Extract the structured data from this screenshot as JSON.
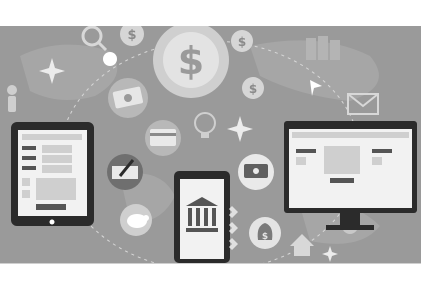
{
  "illustration": {
    "subject": "digital-banking-devices",
    "colors": {
      "background": "#9a9a9a",
      "light_circle": "#bdbdbd",
      "device_dark": "#2b2b2b",
      "screen": "#f2f2f2",
      "accent_dark": "#555555"
    },
    "icons": [
      "dollar-coin-icon",
      "tablet-icon",
      "phone-bank-icon",
      "desktop-monitor-icon",
      "money-bill-icon",
      "piggy-bank-icon",
      "check-signing-icon",
      "credit-card-icon",
      "money-bag-icon",
      "envelope-icon",
      "lightbulb-icon",
      "person-icon",
      "house-icon",
      "cursor-icon",
      "sparkle-icon"
    ]
  }
}
